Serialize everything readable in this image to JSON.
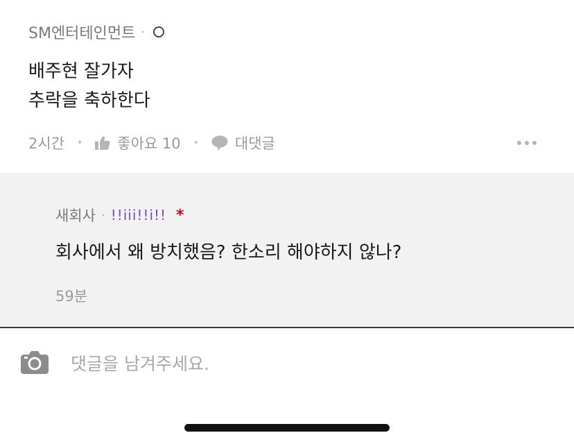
{
  "comment": {
    "author": "SM엔터테인먼트",
    "separator": "·",
    "body_lines": [
      "배주현 잘가자",
      "추락을 축하한다"
    ],
    "time": "2시간",
    "like_label": "좋아요 10",
    "reply_label": "대댓글",
    "icons": {
      "like": "thumbs-up-icon",
      "reply": "speech-bubble-icon",
      "more": "more-dots-icon",
      "badge": "circle-badge-icon"
    }
  },
  "reply": {
    "author": "새회사",
    "separator": "·",
    "nickname": "!!iii!!i!!",
    "marker": "*",
    "text": "회사에서 왜 방치했음? 한소리 해야하지 않나?",
    "time": "59분"
  },
  "input": {
    "placeholder": "댓글을 남겨주세요.",
    "camera_icon": "camera-icon"
  },
  "colors": {
    "reply_background": "#f2f2f2",
    "nickname": "#7b4db5",
    "marker": "#d0021b",
    "muted_text": "#9a9a9a"
  }
}
